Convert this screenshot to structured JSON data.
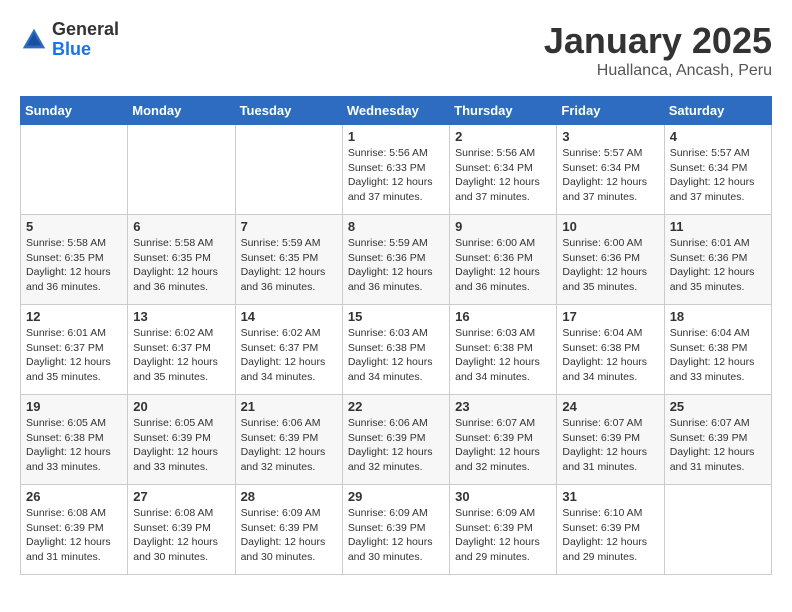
{
  "header": {
    "logo": {
      "general": "General",
      "blue": "Blue"
    },
    "title": "January 2025",
    "location": "Huallanca, Ancash, Peru"
  },
  "weekdays": [
    "Sunday",
    "Monday",
    "Tuesday",
    "Wednesday",
    "Thursday",
    "Friday",
    "Saturday"
  ],
  "weeks": [
    [
      {
        "day": "",
        "info": ""
      },
      {
        "day": "",
        "info": ""
      },
      {
        "day": "",
        "info": ""
      },
      {
        "day": "1",
        "info": "Sunrise: 5:56 AM\nSunset: 6:33 PM\nDaylight: 12 hours\nand 37 minutes."
      },
      {
        "day": "2",
        "info": "Sunrise: 5:56 AM\nSunset: 6:34 PM\nDaylight: 12 hours\nand 37 minutes."
      },
      {
        "day": "3",
        "info": "Sunrise: 5:57 AM\nSunset: 6:34 PM\nDaylight: 12 hours\nand 37 minutes."
      },
      {
        "day": "4",
        "info": "Sunrise: 5:57 AM\nSunset: 6:34 PM\nDaylight: 12 hours\nand 37 minutes."
      }
    ],
    [
      {
        "day": "5",
        "info": "Sunrise: 5:58 AM\nSunset: 6:35 PM\nDaylight: 12 hours\nand 36 minutes."
      },
      {
        "day": "6",
        "info": "Sunrise: 5:58 AM\nSunset: 6:35 PM\nDaylight: 12 hours\nand 36 minutes."
      },
      {
        "day": "7",
        "info": "Sunrise: 5:59 AM\nSunset: 6:35 PM\nDaylight: 12 hours\nand 36 minutes."
      },
      {
        "day": "8",
        "info": "Sunrise: 5:59 AM\nSunset: 6:36 PM\nDaylight: 12 hours\nand 36 minutes."
      },
      {
        "day": "9",
        "info": "Sunrise: 6:00 AM\nSunset: 6:36 PM\nDaylight: 12 hours\nand 36 minutes."
      },
      {
        "day": "10",
        "info": "Sunrise: 6:00 AM\nSunset: 6:36 PM\nDaylight: 12 hours\nand 35 minutes."
      },
      {
        "day": "11",
        "info": "Sunrise: 6:01 AM\nSunset: 6:36 PM\nDaylight: 12 hours\nand 35 minutes."
      }
    ],
    [
      {
        "day": "12",
        "info": "Sunrise: 6:01 AM\nSunset: 6:37 PM\nDaylight: 12 hours\nand 35 minutes."
      },
      {
        "day": "13",
        "info": "Sunrise: 6:02 AM\nSunset: 6:37 PM\nDaylight: 12 hours\nand 35 minutes."
      },
      {
        "day": "14",
        "info": "Sunrise: 6:02 AM\nSunset: 6:37 PM\nDaylight: 12 hours\nand 34 minutes."
      },
      {
        "day": "15",
        "info": "Sunrise: 6:03 AM\nSunset: 6:38 PM\nDaylight: 12 hours\nand 34 minutes."
      },
      {
        "day": "16",
        "info": "Sunrise: 6:03 AM\nSunset: 6:38 PM\nDaylight: 12 hours\nand 34 minutes."
      },
      {
        "day": "17",
        "info": "Sunrise: 6:04 AM\nSunset: 6:38 PM\nDaylight: 12 hours\nand 34 minutes."
      },
      {
        "day": "18",
        "info": "Sunrise: 6:04 AM\nSunset: 6:38 PM\nDaylight: 12 hours\nand 33 minutes."
      }
    ],
    [
      {
        "day": "19",
        "info": "Sunrise: 6:05 AM\nSunset: 6:38 PM\nDaylight: 12 hours\nand 33 minutes."
      },
      {
        "day": "20",
        "info": "Sunrise: 6:05 AM\nSunset: 6:39 PM\nDaylight: 12 hours\nand 33 minutes."
      },
      {
        "day": "21",
        "info": "Sunrise: 6:06 AM\nSunset: 6:39 PM\nDaylight: 12 hours\nand 32 minutes."
      },
      {
        "day": "22",
        "info": "Sunrise: 6:06 AM\nSunset: 6:39 PM\nDaylight: 12 hours\nand 32 minutes."
      },
      {
        "day": "23",
        "info": "Sunrise: 6:07 AM\nSunset: 6:39 PM\nDaylight: 12 hours\nand 32 minutes."
      },
      {
        "day": "24",
        "info": "Sunrise: 6:07 AM\nSunset: 6:39 PM\nDaylight: 12 hours\nand 31 minutes."
      },
      {
        "day": "25",
        "info": "Sunrise: 6:07 AM\nSunset: 6:39 PM\nDaylight: 12 hours\nand 31 minutes."
      }
    ],
    [
      {
        "day": "26",
        "info": "Sunrise: 6:08 AM\nSunset: 6:39 PM\nDaylight: 12 hours\nand 31 minutes."
      },
      {
        "day": "27",
        "info": "Sunrise: 6:08 AM\nSunset: 6:39 PM\nDaylight: 12 hours\nand 30 minutes."
      },
      {
        "day": "28",
        "info": "Sunrise: 6:09 AM\nSunset: 6:39 PM\nDaylight: 12 hours\nand 30 minutes."
      },
      {
        "day": "29",
        "info": "Sunrise: 6:09 AM\nSunset: 6:39 PM\nDaylight: 12 hours\nand 30 minutes."
      },
      {
        "day": "30",
        "info": "Sunrise: 6:09 AM\nSunset: 6:39 PM\nDaylight: 12 hours\nand 29 minutes."
      },
      {
        "day": "31",
        "info": "Sunrise: 6:10 AM\nSunset: 6:39 PM\nDaylight: 12 hours\nand 29 minutes."
      },
      {
        "day": "",
        "info": ""
      }
    ]
  ]
}
